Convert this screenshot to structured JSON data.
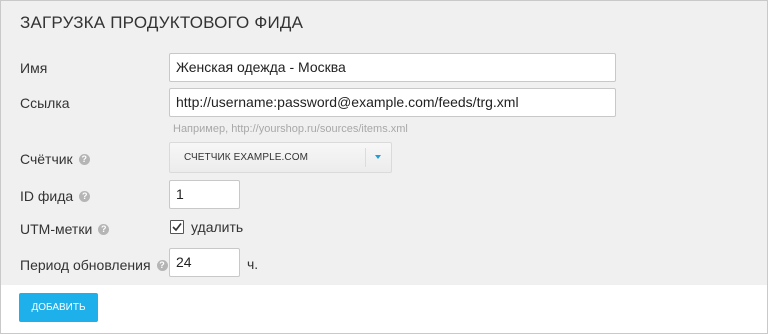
{
  "title": "ЗАГРУЗКА ПРОДУКТОВОГО ФИДА",
  "fields": {
    "name": {
      "label": "Имя",
      "value": "Женская одежда - Москва"
    },
    "link": {
      "label": "Ссылка",
      "value": "http://username:password@example.com/feeds/trg.xml",
      "hint": "Например, http://yourshop.ru/sources/items.xml"
    },
    "counter": {
      "label": "Счётчик",
      "selected": "СЧЕТЧИК EXAMPLE.COM"
    },
    "feed_id": {
      "label": "ID фида",
      "value": "1"
    },
    "utm": {
      "label": "UTM-метки",
      "checkbox_label": "удалить",
      "checked": true
    },
    "period": {
      "label": "Период обновления",
      "value": "24",
      "unit": "ч."
    }
  },
  "help_glyph": "?",
  "actions": {
    "add_label": "ДОБАВИТЬ"
  },
  "colors": {
    "accent": "#1eb0ea",
    "background": "#f0f0f0"
  }
}
